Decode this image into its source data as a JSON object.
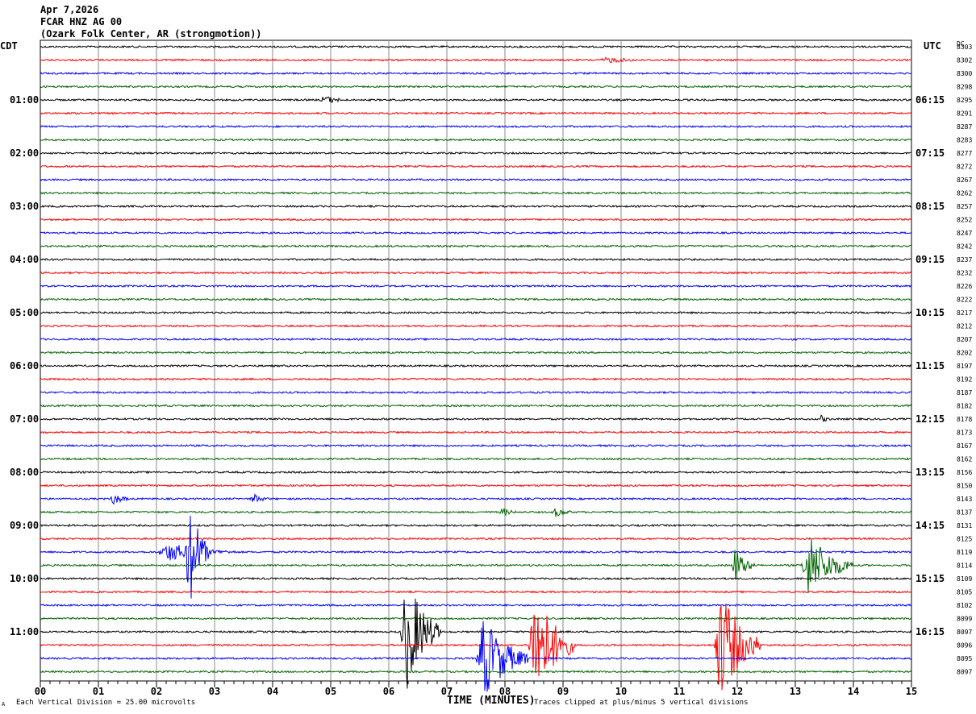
{
  "header": {
    "date": "Apr 7,2026",
    "station": "FCAR HNZ AG 00",
    "location": "(Ozark Folk Center, AR (strongmotion))"
  },
  "chart_data": {
    "type": "line",
    "subtype": "helicorder",
    "xlabel": "TIME (MINUTES)",
    "xlim": [
      0,
      15
    ],
    "x_ticks": [
      "00",
      "01",
      "02",
      "03",
      "04",
      "05",
      "06",
      "07",
      "08",
      "09",
      "10",
      "11",
      "12",
      "13",
      "14",
      "15"
    ],
    "grid": true,
    "left_axis_title": "CDT",
    "right_axis_title": "UTC",
    "dc_title": "DC",
    "left_labels": [
      "01:00",
      "02:00",
      "03:00",
      "04:00",
      "05:00",
      "06:00",
      "07:00",
      "08:00",
      "09:00",
      "10:00",
      "11:00"
    ],
    "right_labels": [
      "06:15",
      "07:15",
      "08:15",
      "09:15",
      "10:15",
      "11:15",
      "12:15",
      "13:15",
      "14:15",
      "15:15",
      "16:15"
    ],
    "trace_colors": [
      "#000000",
      "#ff0000",
      "#0000ff",
      "#006400"
    ],
    "dc_offsets": [
      "8303",
      "8302",
      "8300",
      "8298",
      "8295",
      "8291",
      "8287",
      "8283",
      "8277",
      "8272",
      "8267",
      "8262",
      "8257",
      "8252",
      "8247",
      "8242",
      "8237",
      "8232",
      "8226",
      "8222",
      "8217",
      "8212",
      "8207",
      "8202",
      "8197",
      "8192",
      "8187",
      "8182",
      "8178",
      "8173",
      "8167",
      "8162",
      "8156",
      "8150",
      "8143",
      "8137",
      "8131",
      "8125",
      "8119",
      "8114",
      "8109",
      "8105",
      "8102",
      "8099",
      "8097",
      "8096",
      "8095",
      "8097"
    ],
    "events": [
      {
        "trace": 1,
        "start_min": 9.6,
        "end_min": 10.7,
        "amplitude": 4
      },
      {
        "trace": 4,
        "start_min": 4.8,
        "end_min": 5.4,
        "amplitude": 6
      },
      {
        "trace": 28,
        "start_min": 13.4,
        "end_min": 13.7,
        "amplitude": 5
      },
      {
        "trace": 34,
        "start_min": 1.2,
        "end_min": 1.6,
        "amplitude": 8
      },
      {
        "trace": 34,
        "start_min": 3.6,
        "end_min": 4.0,
        "amplitude": 7
      },
      {
        "trace": 35,
        "start_min": 7.9,
        "end_min": 8.3,
        "amplitude": 6
      },
      {
        "trace": 35,
        "start_min": 8.8,
        "end_min": 9.3,
        "amplitude": 6
      },
      {
        "trace": 38,
        "start_min": 2.0,
        "end_min": 3.4,
        "amplitude": 12
      },
      {
        "trace": 38,
        "start_min": 2.5,
        "end_min": 2.9,
        "amplitude": 80
      },
      {
        "trace": 39,
        "start_min": 11.9,
        "end_min": 12.3,
        "amplitude": 25
      },
      {
        "trace": 39,
        "start_min": 13.1,
        "end_min": 14.0,
        "amplitude": 42
      },
      {
        "trace": 44,
        "start_min": 6.2,
        "end_min": 6.9,
        "amplitude": 75
      },
      {
        "trace": 45,
        "start_min": 8.4,
        "end_min": 9.2,
        "amplitude": 75
      },
      {
        "trace": 45,
        "start_min": 11.6,
        "end_min": 12.4,
        "amplitude": 75
      },
      {
        "trace": 46,
        "start_min": 7.5,
        "end_min": 8.4,
        "amplitude": 55
      }
    ]
  },
  "footer": {
    "scale_note": "Each Vertical Division =   25.00 microvolts",
    "clip_note": "Traces clipped at plus/minus 5 vertical divisions",
    "corner_mark": "A"
  }
}
